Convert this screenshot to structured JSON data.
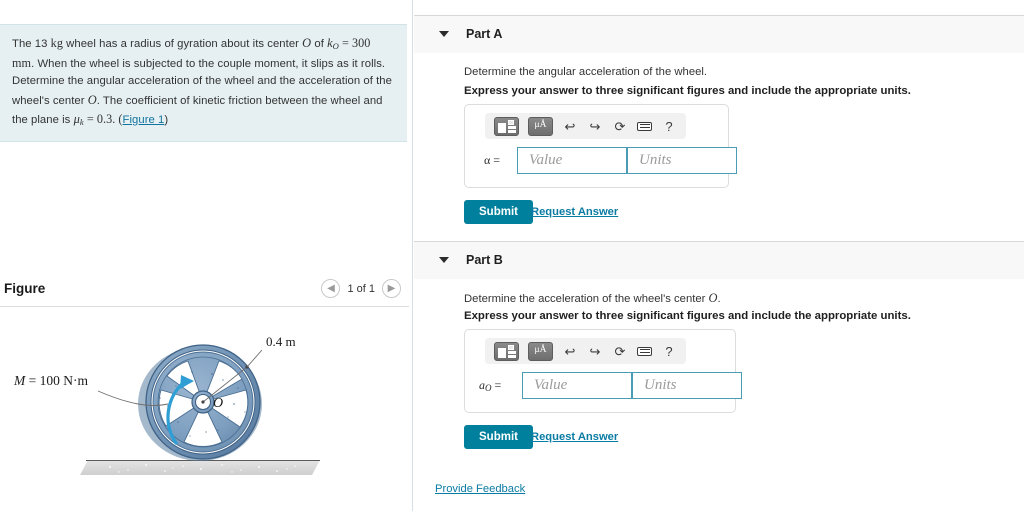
{
  "problem": {
    "line_prefix": "The 13 ",
    "mass_unit": "kg",
    "text_1": " wheel has a radius of gyration about its center ",
    "center_symbol": "O",
    "text_2": " of ",
    "k_symbol": "k",
    "k_sub": "O",
    "k_value": " = 300 ",
    "k_unit": "mm",
    "text_3": ". When the wheel is subjected to the couple moment, it slips as it rolls. Determine the angular acceleration of the wheel and the acceleration of the wheel's center ",
    "center_symbol_2": "O",
    "text_4": ". The coefficient of kinetic friction between the wheel and the plane is ",
    "mu_symbol": "μ",
    "mu_sub": "k",
    "mu_value": " = 0.3. (",
    "figure_link": "Figure 1",
    "text_end": ")"
  },
  "figure": {
    "title": "Figure",
    "count_label": "1 of 1",
    "prev_icon": "chevron-left-icon",
    "next_icon": "chevron-right-icon",
    "moment_label": "M = 100 N·m",
    "moment_symbol": "M",
    "moment_value": " = 100 N·m",
    "radius_label": "0.4 m",
    "center_label": "O",
    "wheel_color": "#7e9fc0",
    "wheel_rim_color": "#5b7fa3",
    "arrow_color": "#2e9ed4",
    "ground_color": "#d9d9d9"
  },
  "parts": [
    {
      "label": "Part A",
      "caret_icon": "caret-down-icon",
      "prompt": "Determine the angular acceleration of the wheel.",
      "instruction": "Express your answer to three significant figures and include the appropriate units.",
      "answer_label": "α",
      "answer_label_sub": "",
      "value_placeholder": "Value",
      "units_placeholder": "Units",
      "value_text": "",
      "units_text": "",
      "submit_label": "Submit",
      "request_label": "Request Answer",
      "toolbar": {
        "template_icon": "math-template-icon",
        "units_icon": "micro-angstrom-units-icon",
        "units_text": "μÅ",
        "undo_icon": "undo-arrow-icon",
        "redo_icon": "redo-arrow-icon",
        "reset_icon": "reset-circle-icon",
        "keyboard_icon": "keyboard-icon",
        "help_icon": "help-question-icon",
        "help_text": "?"
      }
    },
    {
      "label": "Part B",
      "caret_icon": "caret-down-icon",
      "prompt": "Determine the acceleration of the wheel's center O.",
      "prompt_plain": "Determine the acceleration of the wheel's center ",
      "prompt_symbol": "O",
      "prompt_tail": ".",
      "instruction": "Express your answer to three significant figures and include the appropriate units.",
      "answer_label": "a",
      "answer_label_sub": "O",
      "value_placeholder": "Value",
      "units_placeholder": "Units",
      "value_text": "",
      "units_text": "",
      "submit_label": "Submit",
      "request_label": "Request Answer",
      "toolbar": {
        "template_icon": "math-template-icon",
        "units_icon": "micro-angstrom-units-icon",
        "units_text": "μÅ",
        "undo_icon": "undo-arrow-icon",
        "redo_icon": "redo-arrow-icon",
        "reset_icon": "reset-circle-icon",
        "keyboard_icon": "keyboard-icon",
        "help_icon": "help-question-icon",
        "help_text": "?"
      }
    }
  ],
  "footer": {
    "feedback_label": "Provide Feedback"
  },
  "colors": {
    "accent": "#00809c",
    "link": "#0a7ba3",
    "problem_bg": "#e6f0f2",
    "part_header_bg": "#f8f8f8",
    "input_border": "#4a9cb5"
  }
}
